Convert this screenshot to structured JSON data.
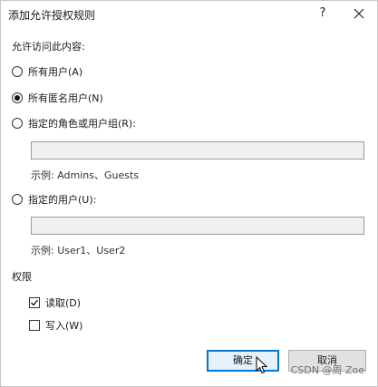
{
  "window": {
    "title": "添加允许授权规则",
    "help_glyph": "?",
    "close_icon": "close-icon"
  },
  "access": {
    "heading": "允许访问此内容:",
    "options": [
      {
        "label": "所有用户(A)",
        "checked": false
      },
      {
        "label": "所有匿名用户(N)",
        "checked": true
      },
      {
        "label": "指定的角色或用户组(R):",
        "checked": false
      },
      {
        "label": "指定的用户(U):",
        "checked": false
      }
    ],
    "roles_input": {
      "value": "",
      "placeholder": ""
    },
    "roles_example": "示例: Admins、Guests",
    "users_input": {
      "value": "",
      "placeholder": ""
    },
    "users_example": "示例: User1、User2"
  },
  "permissions": {
    "heading": "权限",
    "items": [
      {
        "label": "读取(D)",
        "checked": true
      },
      {
        "label": "写入(W)",
        "checked": false
      }
    ]
  },
  "buttons": {
    "ok": "确定",
    "cancel": "取消"
  },
  "watermark": "CSDN @周 Zoe",
  "colors": {
    "accent": "#0078d7",
    "button_bg": "#e1e1e1",
    "input_bg": "#f0f0f0"
  }
}
